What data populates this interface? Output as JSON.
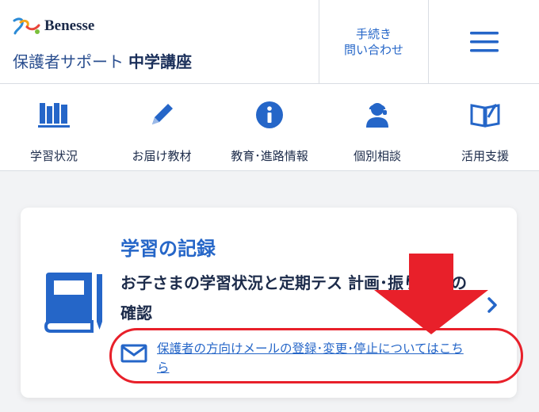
{
  "header": {
    "logo_text": "Benesse",
    "site_title": "保護者サポート",
    "site_title_bold": "中学講座",
    "contact_line1": "手続き",
    "contact_line2": "問い合わせ",
    "menu_icon": "hamburger-menu-icon"
  },
  "nav": {
    "items": [
      {
        "label": "学習状況",
        "icon": "books-icon"
      },
      {
        "label": "お届け教材",
        "icon": "pencil-icon"
      },
      {
        "label": "教育･進路情報",
        "icon": "info-icon"
      },
      {
        "label": "個別相談",
        "icon": "counselor-icon"
      },
      {
        "label": "活用支援",
        "icon": "open-book-icon"
      }
    ]
  },
  "card": {
    "title": "学習の記録",
    "description": "お子さまの学習状況と定期テス     計画･振り返りの確認",
    "link_text": "保護者の方向けメールの登録･変更･停止についてはこちら",
    "icon": "book-icon",
    "link_icon": "mail-icon",
    "chevron_icon": "chevron-right-icon"
  },
  "colors": {
    "accent": "#2566c8",
    "highlight": "#e8202a",
    "text": "#1c2b4a"
  }
}
